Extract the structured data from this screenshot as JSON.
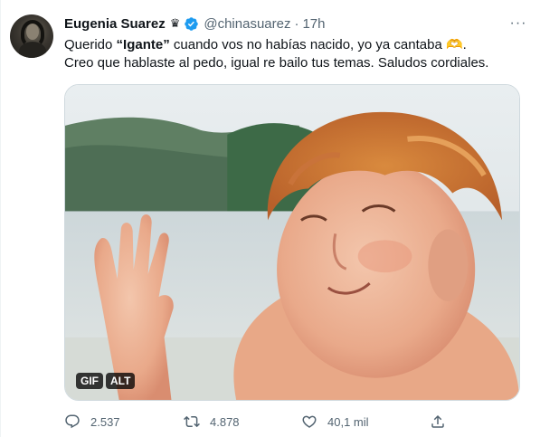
{
  "tweet": {
    "author_name": "Eugenia Suarez",
    "name_emoji": "♛",
    "handle": "@chinasuarez",
    "separator": "·",
    "time": "17h",
    "more_icon": "···",
    "text_part1": "Querido ",
    "text_bold": "“Igante”",
    "text_part2": " cuando vos no habías nacido, yo ya cantaba ",
    "text_emoji": "🫶",
    "text_part3": ".",
    "text_line2": "Creo que hablaste al pedo, igual re bailo tus temas. Saludos cordiales."
  },
  "media": {
    "badge_gif": "GIF",
    "badge_alt": "ALT"
  },
  "actions": {
    "replies": "2.537",
    "retweets": "4.878",
    "likes": "40,1 mil"
  },
  "colors": {
    "verified": "#1d9bf0",
    "secondary_text": "#536471",
    "primary_text": "#0f1419"
  }
}
